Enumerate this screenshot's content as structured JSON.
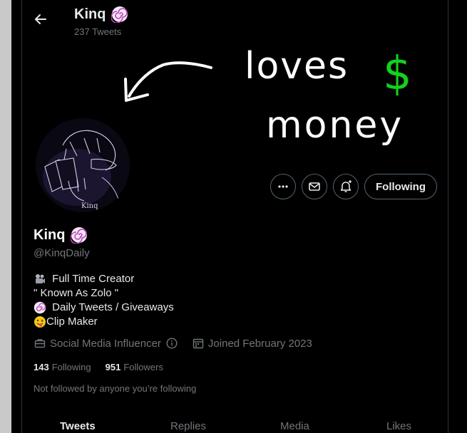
{
  "header": {
    "name": "Kinq",
    "tweet_count": "237 Tweets",
    "back_icon": "arrow-left-icon"
  },
  "banner": {
    "line1": "loves",
    "currency": "$",
    "line2": "money",
    "accent": "#12d21a"
  },
  "avatar": {
    "signature": "Kinq"
  },
  "actions": {
    "more_icon": "more-icon",
    "message_icon": "envelope-icon",
    "notify_icon": "bell-plus-icon",
    "follow_label": "Following"
  },
  "profile": {
    "name": "Kinq",
    "handle": "@KinqDaily",
    "bio": [
      {
        "icon": "camera-icon",
        "text": " Full Time Creator"
      },
      {
        "icon": "",
        "text": "\" Known As Zolo \""
      },
      {
        "icon": "lollipop-icon",
        "text": " Daily Tweets / Giveaways"
      },
      {
        "icon": "tongue-emoji-icon",
        "text": "Clip Maker"
      }
    ],
    "category": "Social Media Influencer",
    "joined": "Joined February 2023",
    "following_count": "143",
    "following_label": "Following",
    "followers_count": "951",
    "followers_label": "Followers",
    "not_followed": "Not followed by anyone you’re following"
  },
  "tabs": [
    "Tweets",
    "Replies",
    "Media",
    "Likes"
  ],
  "colors": {
    "background": "#000000",
    "text": "#e7e9ea",
    "muted": "#71767b",
    "border": "#536471"
  }
}
